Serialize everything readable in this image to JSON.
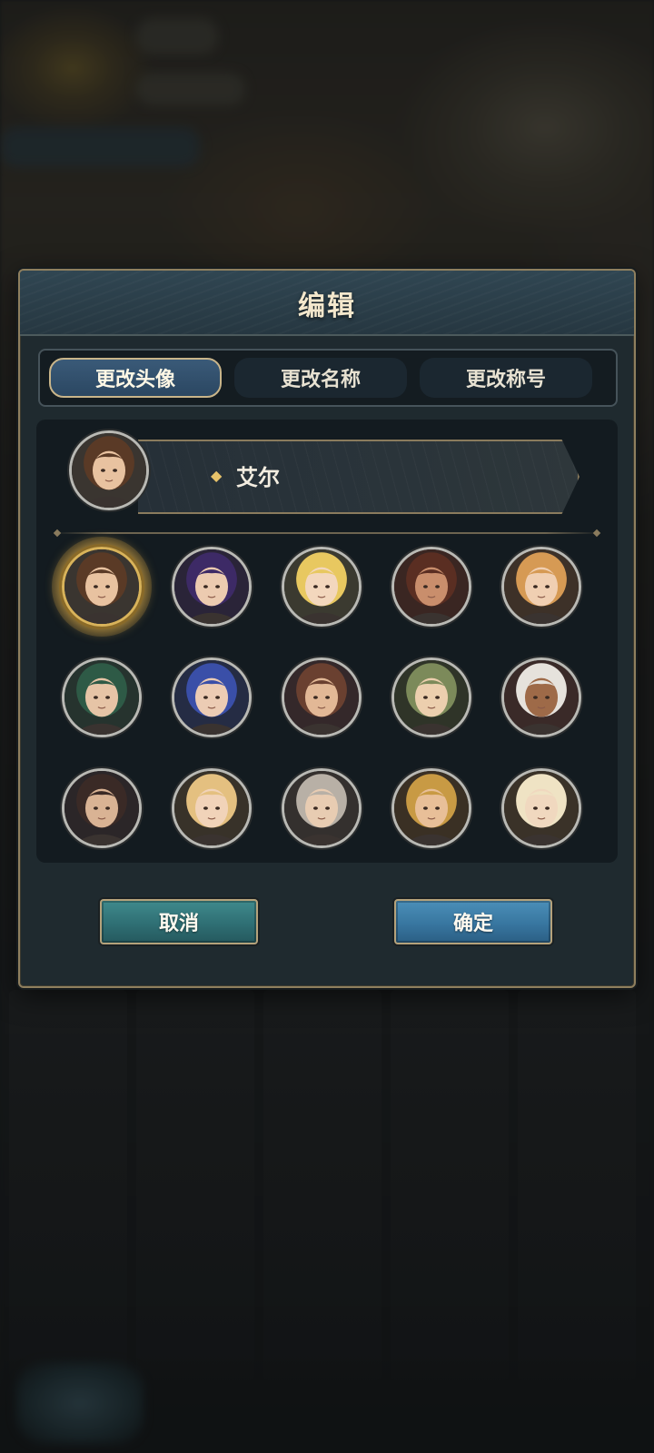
{
  "dialog": {
    "title": "编辑",
    "tabs": [
      {
        "label": "更改头像",
        "active": true
      },
      {
        "label": "更改名称",
        "active": false
      },
      {
        "label": "更改称号",
        "active": false
      }
    ],
    "player_name": "艾尔",
    "cancel_label": "取消",
    "confirm_label": "确定"
  },
  "colors": {
    "accent_gold": "#d9b35a",
    "cancel_button": "#2f6f74",
    "confirm_button": "#3876a0",
    "panel_bg": "#131b20"
  },
  "avatars": [
    {
      "name": "brown-hair-heroine",
      "selected": true,
      "hair": "#5a3a26",
      "skin": "#e8c2a0",
      "bg": "#3a3530"
    },
    {
      "name": "purple-hair-girl",
      "selected": false,
      "hair": "#3d2a66",
      "skin": "#eccbb0",
      "bg": "#2a2438"
    },
    {
      "name": "blonde-elf",
      "selected": false,
      "hair": "#e8c860",
      "skin": "#f3d7bd",
      "bg": "#3b3a30"
    },
    {
      "name": "bearded-man",
      "selected": false,
      "hair": "#5a2e22",
      "skin": "#c98e6c",
      "bg": "#3a2622"
    },
    {
      "name": "ginger-girl",
      "selected": false,
      "hair": "#d69a54",
      "skin": "#f0cfb2",
      "bg": "#3d3128"
    },
    {
      "name": "green-hair-swordsman",
      "selected": false,
      "hair": "#2e5a46",
      "skin": "#e6c4a6",
      "bg": "#26332e"
    },
    {
      "name": "blue-hair-girl",
      "selected": false,
      "hair": "#3a4fa8",
      "skin": "#ecccb4",
      "bg": "#252c44"
    },
    {
      "name": "auburn-hair-man",
      "selected": false,
      "hair": "#6a4030",
      "skin": "#e2b896",
      "bg": "#34282a"
    },
    {
      "name": "green-elf",
      "selected": false,
      "hair": "#7c8a5a",
      "skin": "#eccfae",
      "bg": "#2f3428"
    },
    {
      "name": "white-hair-headband",
      "selected": false,
      "hair": "#e6e2dc",
      "skin": "#9e6a48",
      "bg": "#3a2a28"
    },
    {
      "name": "glasses-man",
      "selected": false,
      "hair": "#3a2a26",
      "skin": "#d9b394",
      "bg": "#2b2628"
    },
    {
      "name": "blonde-girl-hairclip",
      "selected": false,
      "hair": "#e4c080",
      "skin": "#f1d3b9",
      "bg": "#383229"
    },
    {
      "name": "silver-hair-youth",
      "selected": false,
      "hair": "#b8b0a6",
      "skin": "#e8ccb2",
      "bg": "#34302e"
    },
    {
      "name": "golden-hair-man",
      "selected": false,
      "hair": "#c89a44",
      "skin": "#e8bf98",
      "bg": "#3a3024"
    },
    {
      "name": "hat-blonde",
      "selected": false,
      "hair": "#efe3c4",
      "skin": "#f0d8bf",
      "bg": "#3a3228"
    }
  ]
}
